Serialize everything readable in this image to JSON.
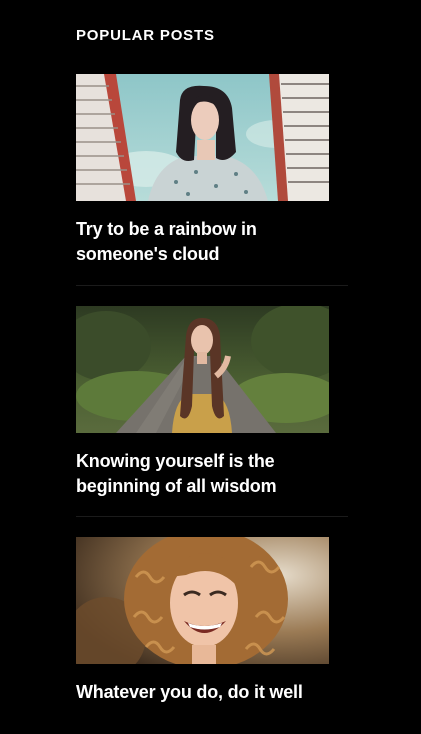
{
  "widget": {
    "title": "POPULAR POSTS"
  },
  "posts": [
    {
      "title": "Try to be a rainbow in someone's cloud",
      "thumbnail": "woman-between-buildings-photo"
    },
    {
      "title": "Knowing yourself is the beginning of all wisdom",
      "thumbnail": "woman-on-forest-road-photo"
    },
    {
      "title": "Whatever you do, do it well",
      "thumbnail": "laughing-curly-haired-woman-photo"
    }
  ],
  "colors": {
    "background": "#000000",
    "text": "#ffffff",
    "divider": "#1b1b1b"
  }
}
